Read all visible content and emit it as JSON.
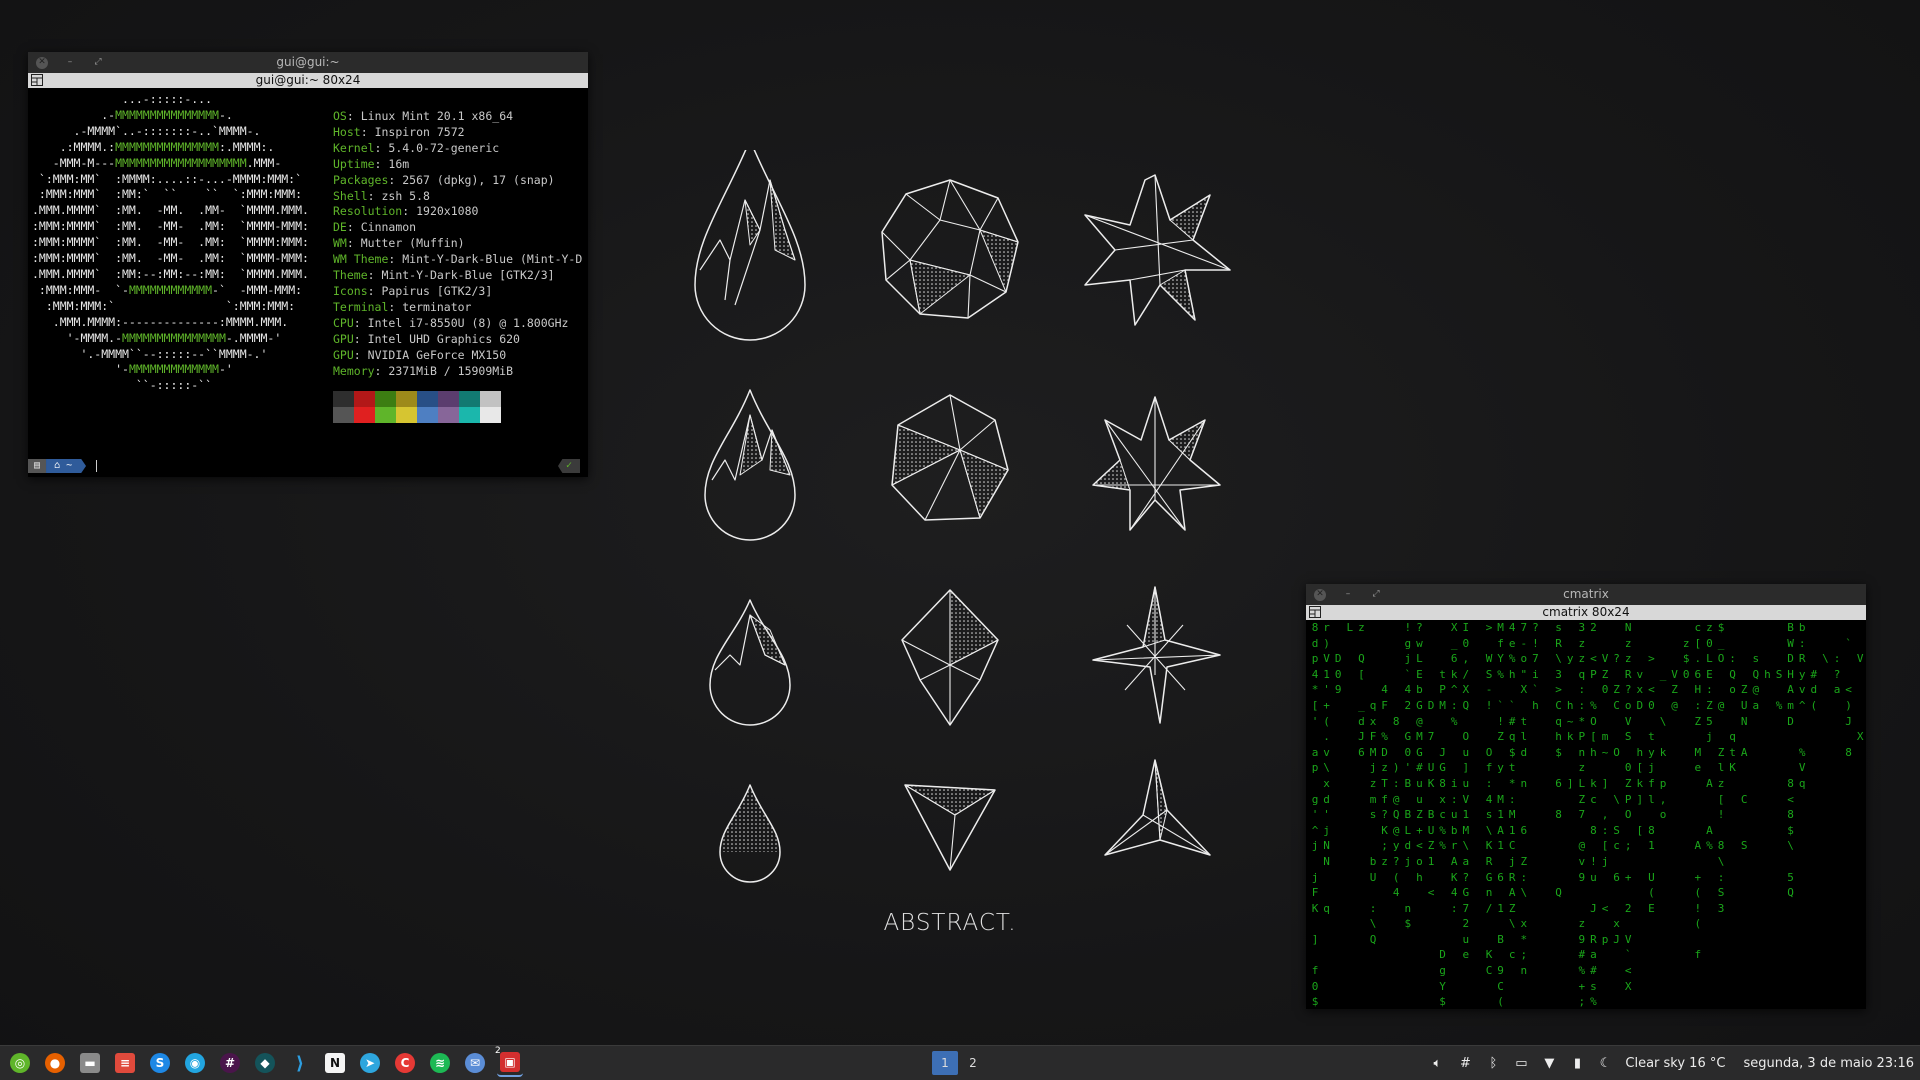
{
  "terminal": {
    "title": "gui@gui:~",
    "subtitle": "gui@gui:~ 80x24",
    "logo_lines": [
      "             ...-:::::-...",
      "          .-MMMMMMMMMMMMMMM-.",
      "      .-MMMM`..-:::::::-..`MMMM-.",
      "    .:MMMM.:MMMMMMMMMMMMMMM:.MMMM:.",
      "   -MMM-M---MMMMMMMMMMMMMMMMMMM.MMM-",
      " `:MMM:MM`  :MMMM:....::-...-MMMM:MMM:`",
      " :MMM:MMM`  :MM:`  ``    ``  `:MMM:MMM:",
      ".MMM.MMMM`  :MM.  -MM.  .MM-  `MMMM.MMM.",
      ":MMM:MMMM`  :MM.  -MM-  .MM:  `MMMM-MMM:",
      ":MMM:MMMM`  :MM.  -MM-  .MM:  `MMMM:MMM:",
      ":MMM:MMMM`  :MM.  -MM-  .MM:  `MMMM-MMM:",
      ".MMM.MMMM`  :MM:--:MM:--:MM:  `MMMM.MMM.",
      " :MMM:MMM-  `-MMMMMMMMMMMM-`  -MMM-MMM:",
      "  :MMM:MMM:`                `:MMM:MMM:",
      "   .MMM.MMMM:--------------:MMMM.MMM.",
      "     '-MMMM.-MMMMMMMMMMMMMMM-.MMMM-'",
      "       '.-MMMM``--:::::--``MMMM-.'",
      "            '-MMMMMMMMMMMMM-'",
      "               ``-:::::-``"
    ],
    "info": [
      {
        "k": "OS",
        "v": "Linux Mint 20.1 x86_64"
      },
      {
        "k": "Host",
        "v": "Inspiron 7572"
      },
      {
        "k": "Kernel",
        "v": "5.4.0-72-generic"
      },
      {
        "k": "Uptime",
        "v": "16m"
      },
      {
        "k": "Packages",
        "v": "2567 (dpkg), 17 (snap)"
      },
      {
        "k": "Shell",
        "v": "zsh 5.8"
      },
      {
        "k": "Resolution",
        "v": "1920x1080"
      },
      {
        "k": "DE",
        "v": "Cinnamon"
      },
      {
        "k": "WM",
        "v": "Mutter (Muffin)"
      },
      {
        "k": "WM Theme",
        "v": "Mint-Y-Dark-Blue (Mint-Y-D"
      },
      {
        "k": "Theme",
        "v": "Mint-Y-Dark-Blue [GTK2/3]"
      },
      {
        "k": "Icons",
        "v": "Papirus [GTK2/3]"
      },
      {
        "k": "Terminal",
        "v": "terminator"
      },
      {
        "k": "CPU",
        "v": "Intel i7-8550U (8) @ 1.800GHz"
      },
      {
        "k": "GPU",
        "v": "Intel UHD Graphics 620"
      },
      {
        "k": "GPU",
        "v": "NVIDIA GeForce MX150"
      },
      {
        "k": "Memory",
        "v": "2371MiB / 15909MiB"
      }
    ],
    "palette_top": [
      "#2e2e2e",
      "#b21818",
      "#3c7d12",
      "#9d8a1a",
      "#284f86",
      "#5b3d6e",
      "#127a72",
      "#c2c2c2"
    ],
    "palette_bottom": [
      "#555555",
      "#e02020",
      "#5fb52a",
      "#d6c531",
      "#4e7fc2",
      "#876699",
      "#1bb7ac",
      "#e8e8e8"
    ],
    "prompt_dir": "~",
    "prompt_ok": "✓"
  },
  "matrix_window": {
    "title": "cmatrix",
    "subtitle": "cmatrix 80x24",
    "columns": [
      "8dp4*[' ap\tg'^j jFK ] f0$ ]Y",
      "r)V1'+(.v\\xd'jNN  q",
      "  D09  ",
      "L     ",
      "z Q[ _dJ6 ",
      "     qxFMjzms  bU :\\Q",
      "    4F %DzTf?K;z",
      "      8  ):@Q@y?(4",
      "!gj`42 G0'B BLdj  n$ ",
      "?wLEbG@MG#uuZ+<oh ",
      "     D 7 UK BUZ1 <",
      "   tPM  JG8xc%%      DgY$]C,%",
      "X_6k^:%   i:ubrAK4:",
      "I0,/XQ Ou]uV1M\\a?G72ue ",
      "  ",
      "> WS-!  Of:4s\\KRGn/  KC",
      "MfY% `!Z y M1A1 6 1 B 9C( ",
      "4e%h `#q$t*:M1CjRAZ\\ c",
      "7-o\"X tld n  6 Z:\\ x*;n",
      "?!7i`h ",
      "  ",
      "sR\\3>Cqh$ 6 8    Q",
      "  y  h~k  ] ",
      "3zzq::*PnzLZ7 @v9  z9#%+;",
      "2 <P %O[h kc 8 !u J Ra#s%\\-",
      "  VZ0  m~ ] ,:[j  < p",
      "  ? ZC  O  \\ Sc 6  xJ ",
      "NzzR?oVS 0ZPO ; + 2 V`<X",
      "   vxD  h[k] [  ",
      "  > <0 tyjfl 81 U(E",
      "   _  \\ k p,o",
      "   VZ@ ",
      " z$0 ",
      "c[.6H:Z Me    A +(!( f    *P*",
      "z0LE:Z5j  A  A%",
      "$_O  @  Zlz[! 8\\:S3",
      "  :Qo  qtK  ",
      "    ZUN A  C  S",
      "  sQ@a  ",
      "   h   ",
      "   S %",
      "BWDHAmD   8<8$\\ 5Q",
      "b:Ryv^  %Vq",
      "   #d(",
      "  \\ ",
      "  :?a",
      " `  <)J 8",
      "  V    X"
    ]
  },
  "wallpaper": {
    "caption": "ABSTRACT."
  },
  "taskbar": {
    "apps": [
      {
        "name": "menu-icon",
        "color": "#5fb52a",
        "glyph": "◎"
      },
      {
        "name": "firefox-icon",
        "color": "#e66000",
        "glyph": "●"
      },
      {
        "name": "files-icon",
        "color": "#8a8a8a",
        "glyph": "▬"
      },
      {
        "name": "notes-icon",
        "color": "#e04a3c",
        "glyph": "≡"
      },
      {
        "name": "skype-icon",
        "color": "#1e88e5",
        "glyph": "S"
      },
      {
        "name": "app-blue-icon",
        "color": "#22a5e0",
        "glyph": "◉"
      },
      {
        "name": "slack-icon",
        "color": "#4a154b",
        "glyph": "#"
      },
      {
        "name": "gitkraken-icon",
        "color": "#14535a",
        "glyph": "◆"
      },
      {
        "name": "vscode-icon",
        "color": "#2a2a2b",
        "glyph": "⟩"
      },
      {
        "name": "notion-icon",
        "color": "#f5f5f5",
        "glyph": "N"
      },
      {
        "name": "telegram-icon",
        "color": "#2ea6de",
        "glyph": "➤"
      },
      {
        "name": "podcast-icon",
        "color": "#e53935",
        "glyph": "C"
      },
      {
        "name": "spotify-icon",
        "color": "#1db954",
        "glyph": "≋"
      },
      {
        "name": "chat-icon",
        "color": "#5b8dd6",
        "glyph": "✉"
      },
      {
        "name": "terminal-app-icon",
        "color": "#d32f2f",
        "glyph": "▣"
      }
    ],
    "badge": "2",
    "workspaces": [
      "1",
      "2"
    ],
    "weather": "Clear sky 16 °C",
    "datetime": "segunda, 3 de maio 23:16"
  }
}
